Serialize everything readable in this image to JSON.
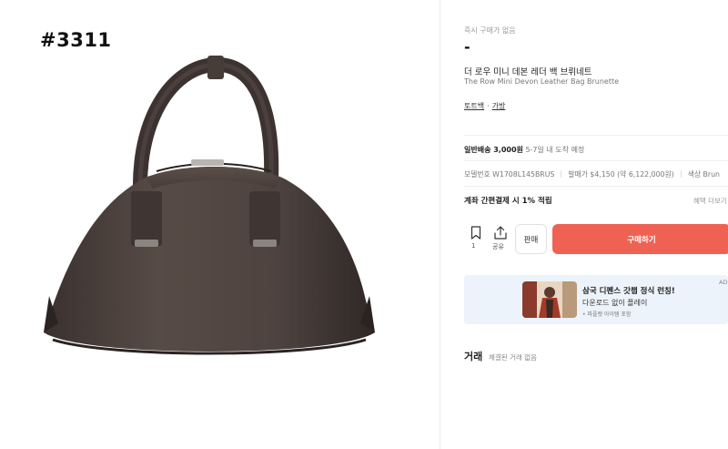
{
  "left": {
    "code": "#3311"
  },
  "right": {
    "immediate_label": "즉시 구매가 없음",
    "price": "-",
    "title_ko": "더 로우 미니 데본 레더 백 브뤼네트",
    "title_en": "The Row Mini Devon Leather Bag Brunette",
    "category": {
      "main": "토트백",
      "separator": "·",
      "sub": "가방"
    },
    "shipping": {
      "label": "일반배송 3,000원",
      "eta": "5-7일 내 도착 예정"
    },
    "specs": {
      "model": "모델번호 W1708L145BRUS",
      "release_price": "발매가 $4,150 (약 6,122,000원)",
      "color": "색상 Brun"
    },
    "payment": {
      "label": "계좌 간편결제 시 1% 적립",
      "more": "혜택 더보기"
    },
    "actions": {
      "bookmark_count": "1",
      "share_label": "공유",
      "sell_label": "판매",
      "buy_label": "구매하기"
    },
    "ad": {
      "title": "삼국 디펜스 갓챕 정식 런칭!",
      "subtitle": "다운로드 없이 플레이",
      "note": "• 파플랫 아이템 포함",
      "badge": "AD"
    },
    "trades": {
      "title": "거래",
      "empty": "체결된 거래 없음"
    }
  },
  "colors": {
    "buy_button": "#ef6253",
    "ad_background": "#edf3fa",
    "bag_leather": "#4a403c"
  },
  "icons": [
    "bookmark-icon",
    "share-icon"
  ]
}
